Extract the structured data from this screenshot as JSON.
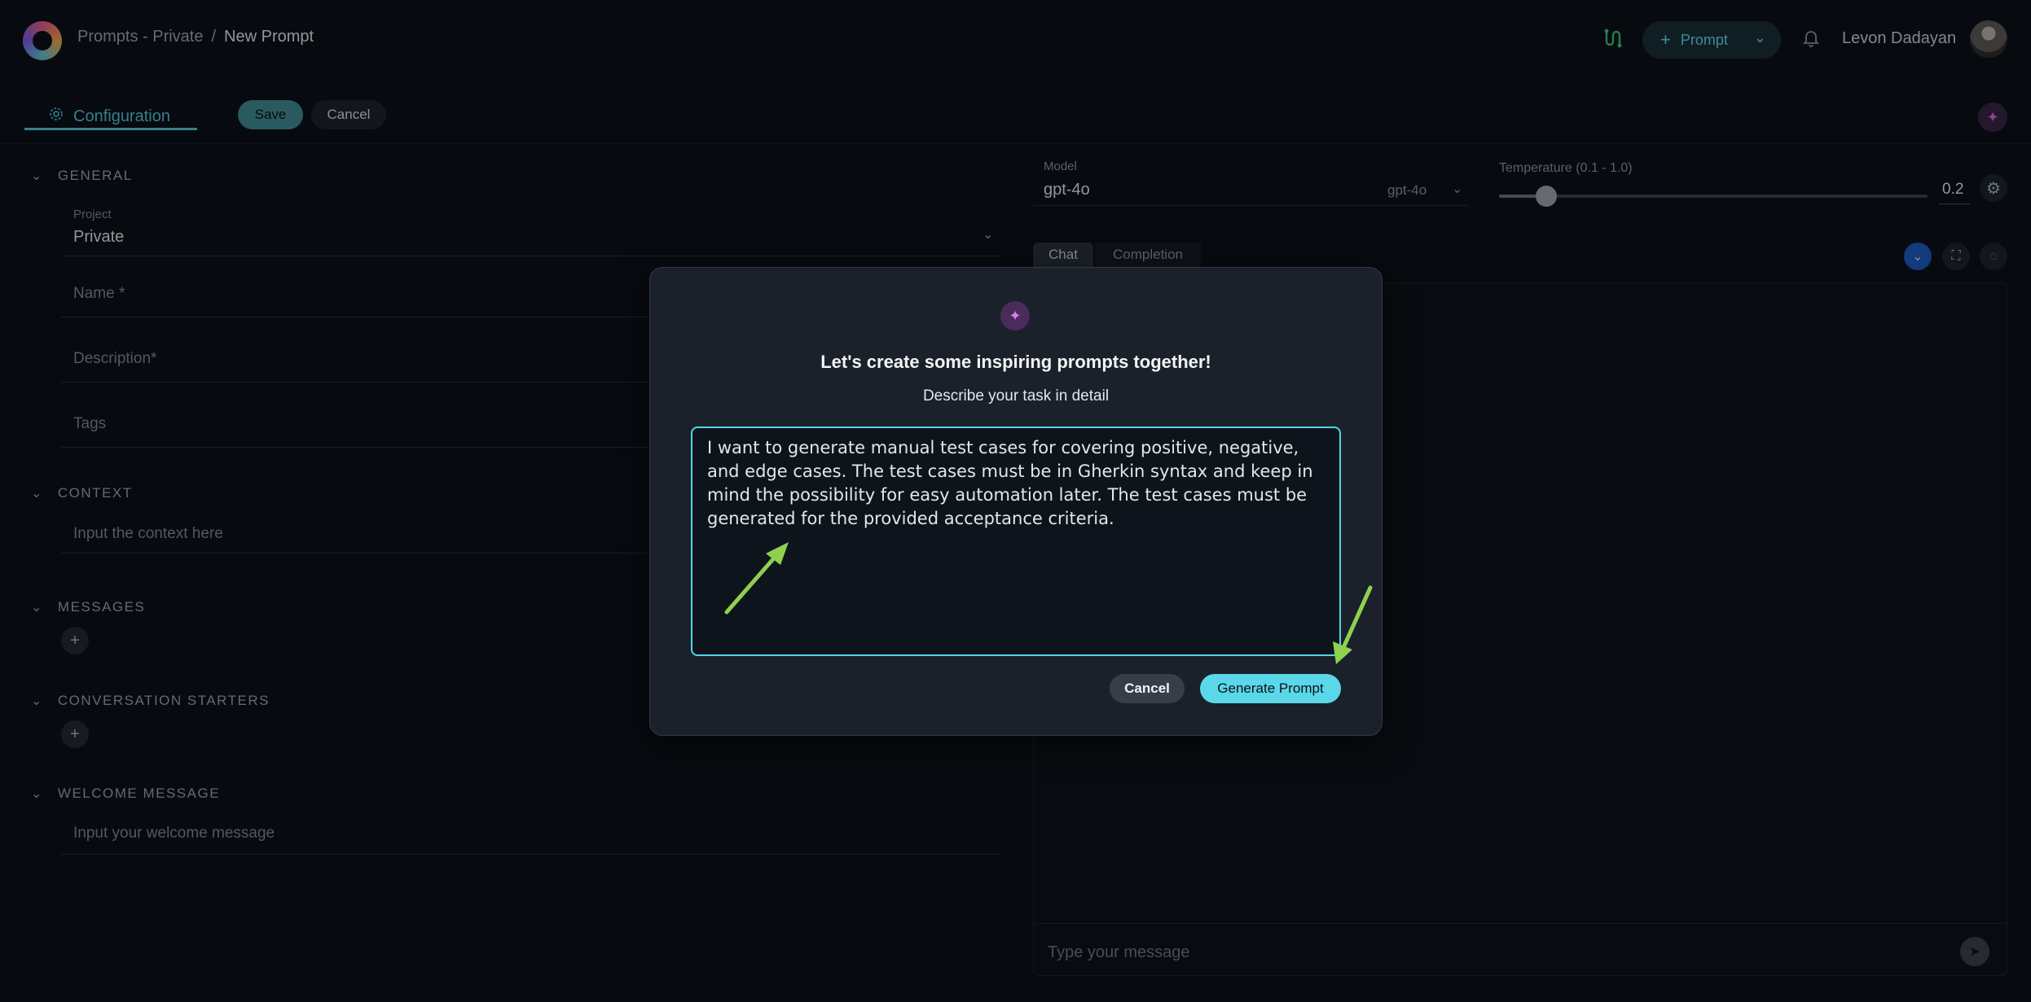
{
  "header": {
    "breadcrumb": [
      "Prompts - Private",
      "/",
      "New Prompt"
    ],
    "prompt_button": "Prompt",
    "user_name": "Levon Dadayan"
  },
  "toolbar": {
    "config_tab": "Configuration",
    "save_label": "Save",
    "cancel_label": "Cancel"
  },
  "form": {
    "general": {
      "heading": "GENERAL",
      "project_label": "Project",
      "project_value": "Private",
      "name_label": "Name *",
      "description_label": "Description*",
      "tags_label": "Tags"
    },
    "context": {
      "heading": "CONTEXT",
      "placeholder": "Input the context here"
    },
    "messages": {
      "heading": "MESSAGES"
    },
    "conversation_starters": {
      "heading": "CONVERSATION STARTERS"
    },
    "welcome_message": {
      "heading": "WELCOME MESSAGE",
      "placeholder": "Input your welcome message"
    }
  },
  "model_panel": {
    "model_label": "Model",
    "model_value": "gpt-4o",
    "model_select": "gpt-4o",
    "temperature_label": "Temperature (0.1 - 1.0)",
    "temperature_value": "0.2",
    "temperature_fraction": 0.11,
    "tabs": [
      "Chat",
      "Completion"
    ],
    "chat_placeholder": "Type your message"
  },
  "modal": {
    "title": "Let's create some inspiring prompts together!",
    "subtitle": "Describe your task in detail",
    "task_text": "I want to generate manual test cases for covering positive, negative, and edge cases. The test cases must be in Gherkin syntax and keep in mind the possibility for easy automation later. The test cases must be generated for the provided acceptance criteria.",
    "cancel_label": "Cancel",
    "generate_label": "Generate Prompt"
  },
  "colors": {
    "accent": "#52d4e6",
    "arrow": "#8fd14f"
  }
}
